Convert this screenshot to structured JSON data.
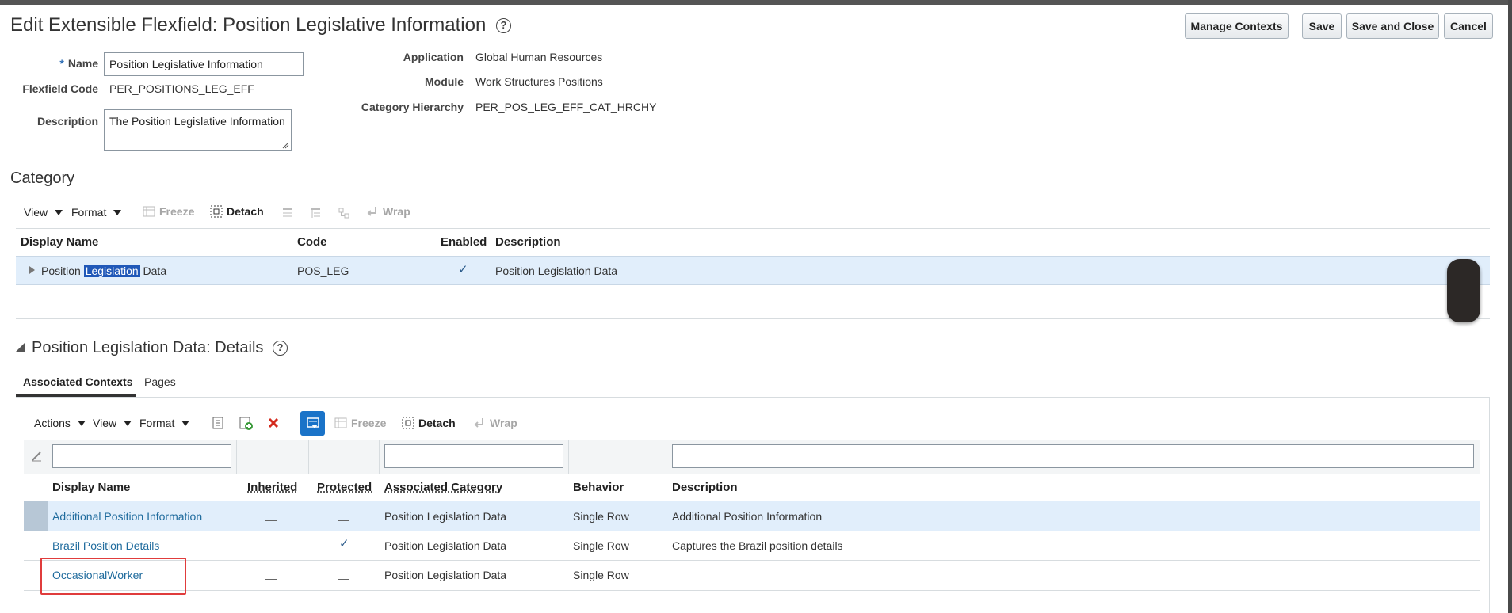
{
  "header": {
    "title": "Edit Extensible Flexfield: Position Legislative Information",
    "help_glyph": "?",
    "buttons": {
      "manage_contexts": "Manage Contexts",
      "save": "Save",
      "save_and_close": "Save and Close",
      "cancel": "Cancel"
    }
  },
  "form": {
    "required_mark": "*",
    "name_label": "Name",
    "name_value": "Position Legislative Information",
    "code_label": "Flexfield Code",
    "code_value": "PER_POSITIONS_LEG_EFF",
    "description_label": "Description",
    "description_value": "The Position Legislative Information",
    "application_label": "Application",
    "application_value": "Global Human Resources",
    "module_label": "Module",
    "module_value": "Work Structures Positions",
    "hierarchy_label": "Category Hierarchy",
    "hierarchy_value": "PER_POS_LEG_EFF_CAT_HRCHY"
  },
  "category": {
    "title": "Category",
    "toolbar": {
      "view": "View",
      "format": "Format",
      "freeze": "Freeze",
      "detach": "Detach",
      "wrap": "Wrap"
    },
    "columns": [
      "Display Name",
      "Code",
      "Enabled",
      "Description"
    ],
    "row": {
      "name_before": "Position ",
      "name_highlight": "Legislation",
      "name_after": " Data",
      "code": "POS_LEG",
      "enabled": "✓",
      "description": "Position Legislation Data"
    }
  },
  "details": {
    "title": "Position Legislation Data: Details",
    "tabs": [
      "Associated Contexts",
      "Pages"
    ],
    "toolbar": {
      "actions": "Actions",
      "view": "View",
      "format": "Format",
      "freeze": "Freeze",
      "detach": "Detach",
      "wrap": "Wrap"
    },
    "columns": [
      "Display Name",
      "Inherited",
      "Protected",
      "Associated Category",
      "Behavior",
      "Description"
    ],
    "rows": [
      {
        "name": "Additional Position Information",
        "protected": "",
        "category": "Position Legislation Data",
        "behavior": "Single Row",
        "description": "Additional Position Information"
      },
      {
        "name": "Brazil Position Details",
        "protected": "✓",
        "category": "Position Legislation Data",
        "behavior": "Single Row",
        "description": "Captures the Brazil position details"
      },
      {
        "name": "OccasionalWorker",
        "protected": "",
        "category": "Position Legislation Data",
        "behavior": "Single Row",
        "description": ""
      }
    ]
  },
  "colors": {
    "link": "#1f6b9d",
    "selected_row": "#e1eefb",
    "highlight_box": "#e03c3c",
    "accent_blue": "#1a73c8"
  }
}
